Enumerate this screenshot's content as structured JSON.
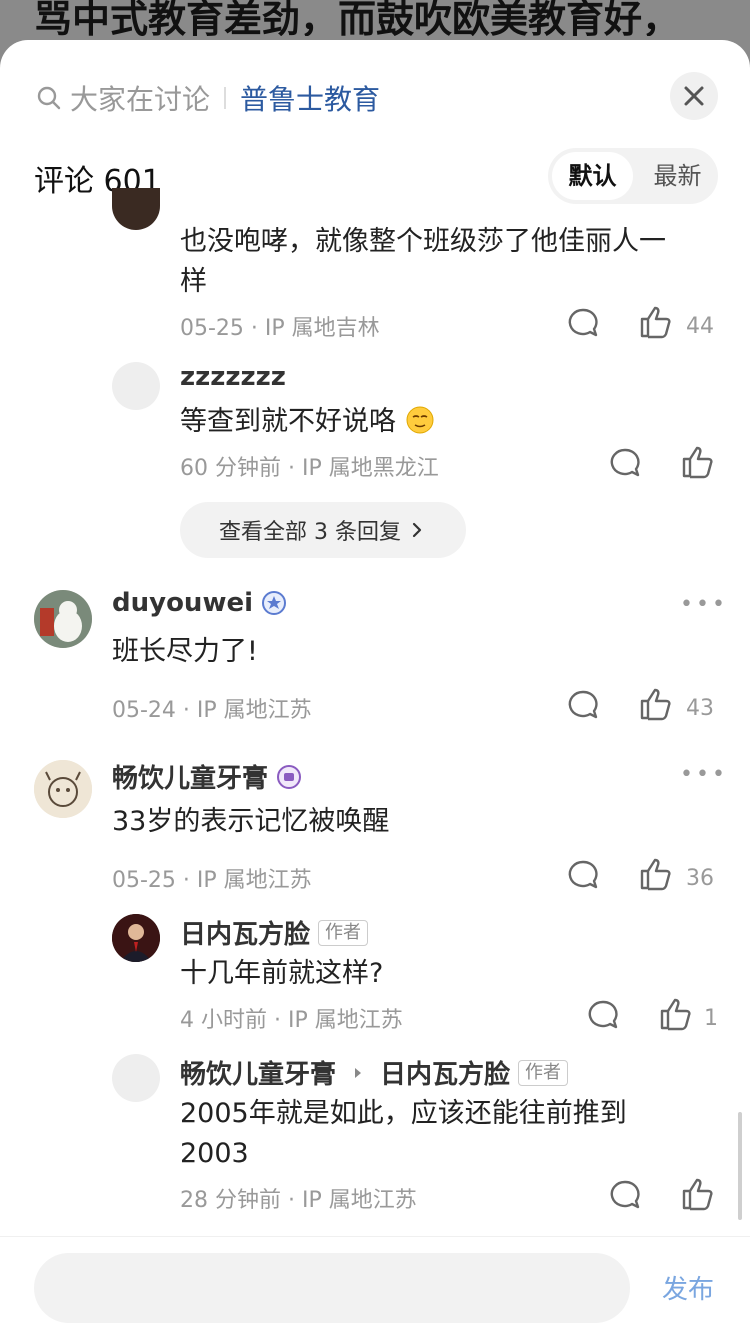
{
  "background": {
    "title": "骂中式教育差劲，而鼓吹欧美教育好，"
  },
  "header": {
    "search_placeholder": "大家在讨论",
    "topic": "普鲁士教育",
    "close_icon": "close-icon"
  },
  "comments_header": {
    "label": "评论 601",
    "sort_options": [
      "默认",
      "最新"
    ],
    "active_sort": "默认"
  },
  "reply1": {
    "text_line1": "也没咆哮，就像整个班级莎了他佳丽人一",
    "text_line2": "样",
    "meta": "05-25 · IP 属地吉林",
    "likes": "44"
  },
  "reply2": {
    "name": "zzzzzzz",
    "text": "等查到就不好说咯",
    "meta": "60 分钟前 · IP 属地黑龙江"
  },
  "view_all": {
    "label": "查看全部 3 条回复"
  },
  "comment1": {
    "name": "duyouwei",
    "text": "班长尽力了!",
    "meta": "05-24 · IP 属地江苏",
    "likes": "43"
  },
  "comment2": {
    "name": "畅饮儿童牙膏",
    "text": "33岁的表示记忆被唤醒",
    "meta": "05-25 · IP 属地江苏",
    "likes": "36"
  },
  "reply3": {
    "name": "日内瓦方脸",
    "badge": "作者",
    "text": "十几年前就这样?",
    "meta": "4 小时前 · IP 属地江苏",
    "likes": "1"
  },
  "reply4": {
    "name": "畅饮儿童牙膏",
    "to_name": "日内瓦方脸",
    "badge": "作者",
    "text_line1": "2005年就是如此，应该还能往前推到",
    "text_line2": "2003",
    "meta": "28 分钟前 · IP 属地江苏"
  },
  "bottom": {
    "publish": "发布"
  },
  "colors": {
    "accent": "#2c5aa0",
    "publish": "#7aa6e0",
    "meta": "#999999"
  }
}
